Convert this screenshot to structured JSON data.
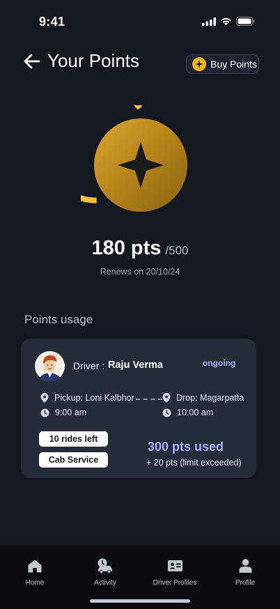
{
  "status_bar": {
    "time": "9:41"
  },
  "header": {
    "title": "Your Points",
    "buy_label": "Buy Points"
  },
  "points": {
    "value": "180 pts",
    "total": "/500",
    "fraction": 0.36,
    "renews": "Renews on 20/10/24",
    "colors": {
      "ring": "#f5c03a",
      "coin": "#b8861b"
    }
  },
  "usage": {
    "section_title": "Points usage",
    "card": {
      "driver_label": "Driver :",
      "driver_name": "Raju Verma",
      "status": "ongoing",
      "pickup": "Pickup: Loni Kalbhor",
      "pickup_time": "9:00 am",
      "drop": "Drop: Magarpatta",
      "drop_time": "10:00 am",
      "rides_left": "10 rides left",
      "service": "Cab Service",
      "pts_used": "300 pts used",
      "pts_extra": "+ 20 pts (limit exceeded)"
    }
  },
  "tabs": [
    {
      "label": "Home",
      "icon": "home-icon"
    },
    {
      "label": "Activity",
      "icon": "activity-icon"
    },
    {
      "label": "Driver Profiles",
      "icon": "id-card-icon"
    },
    {
      "label": "Profile",
      "icon": "user-icon"
    }
  ]
}
